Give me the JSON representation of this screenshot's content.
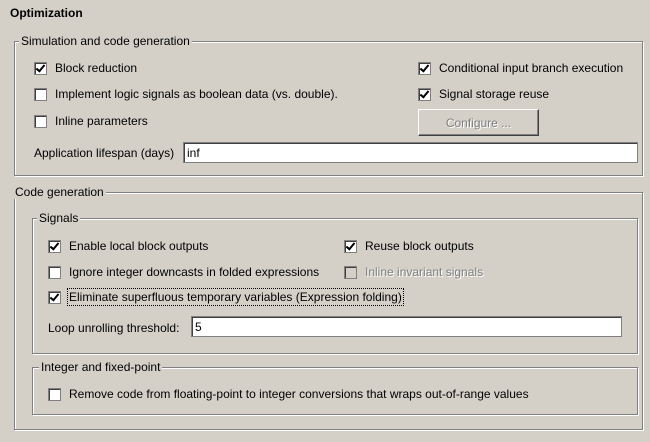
{
  "page_title": "Optimization",
  "simulation": {
    "legend": "Simulation and code generation",
    "block_reduction": "Block reduction",
    "implement_logic": "Implement logic signals as boolean data (vs. double).",
    "inline_parameters": "Inline parameters",
    "conditional_input": "Conditional input branch execution",
    "signal_storage": "Signal storage reuse",
    "configure_button": "Configure ...",
    "lifespan_label": "Application lifespan (days)",
    "lifespan_value": "inf"
  },
  "code_generation": {
    "legend": "Code generation",
    "signals": {
      "legend": "Signals",
      "enable_local": "Enable local block outputs",
      "reuse_block": "Reuse block outputs",
      "ignore_integer": "Ignore integer downcasts in folded expressions",
      "inline_invariant": "Inline invariant signals",
      "eliminate_superfluous": "Eliminate superfluous temporary variables (Expression folding)",
      "loop_label": "Loop unrolling threshold:",
      "loop_value": "5"
    },
    "integer": {
      "legend": "Integer and fixed-point",
      "remove_code": "Remove code from floating-point to integer conversions that wraps out-of-range values"
    }
  }
}
